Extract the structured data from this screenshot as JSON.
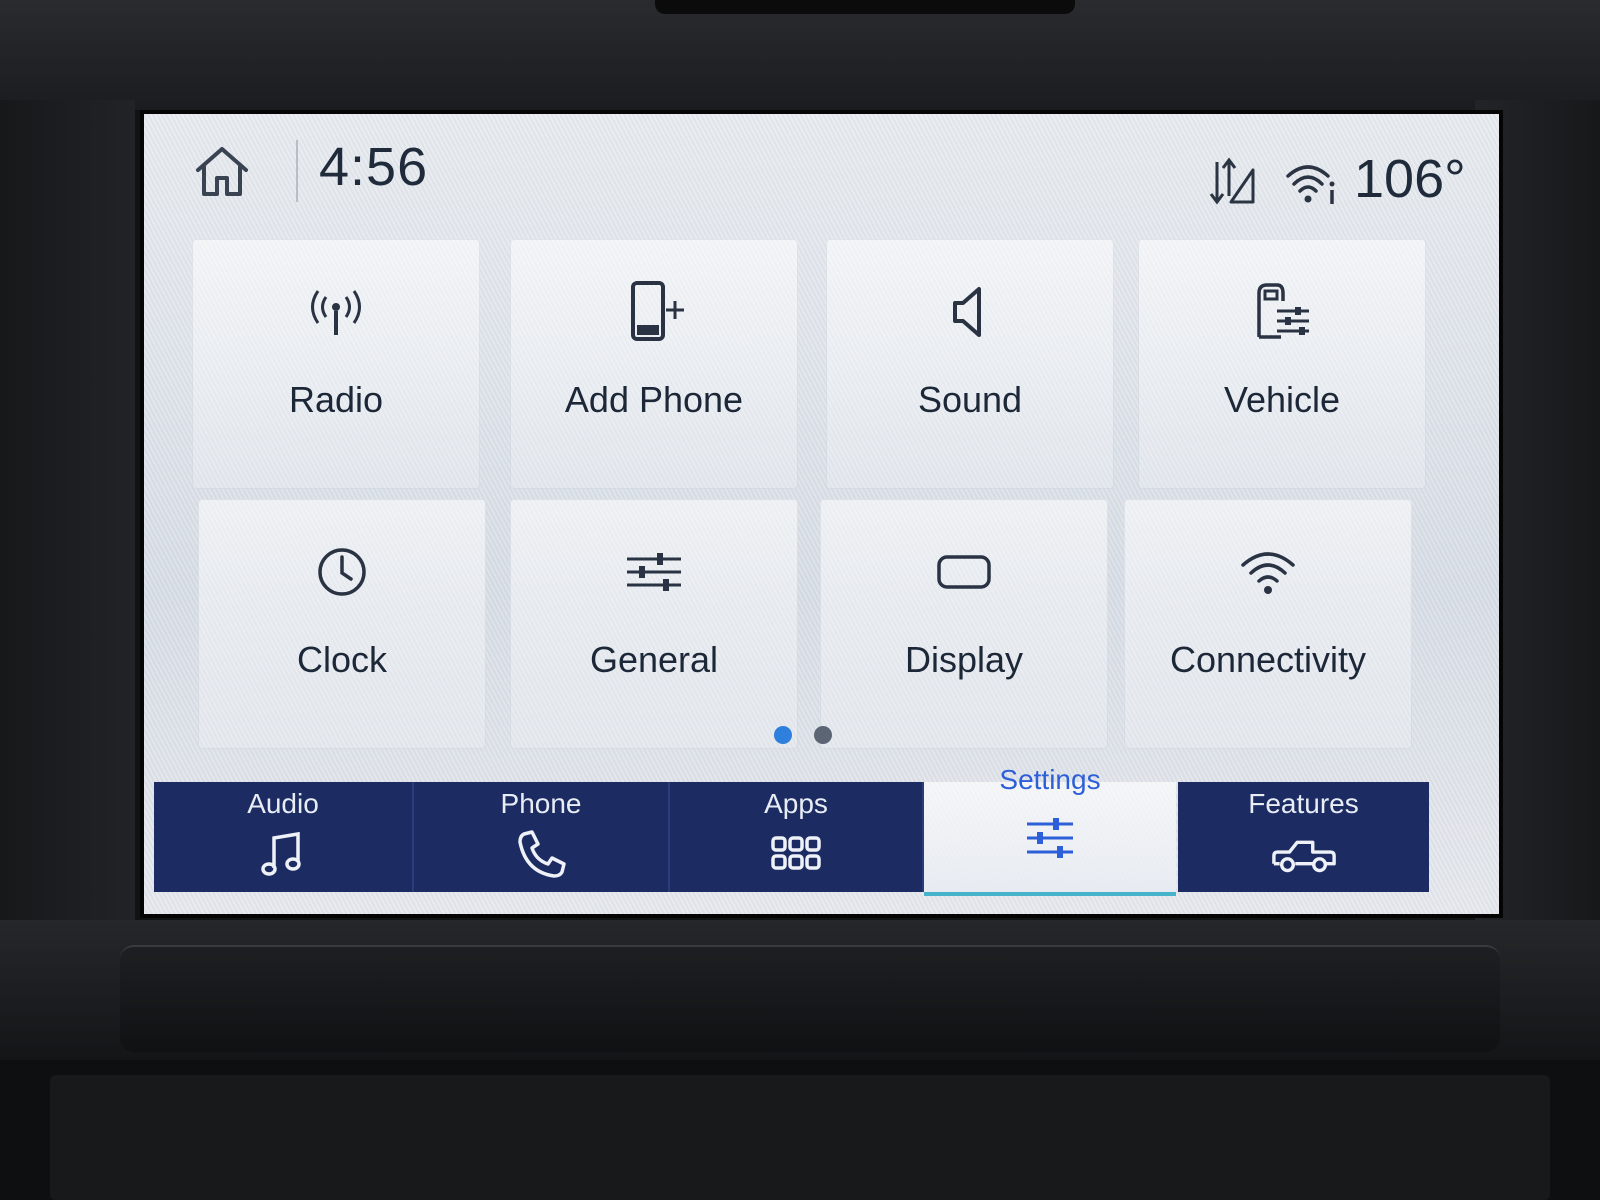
{
  "status": {
    "time": "4:56",
    "temperature": "106°"
  },
  "tiles": [
    {
      "label": "Radio",
      "icon": "radio-antenna-icon"
    },
    {
      "label": "Add Phone",
      "icon": "add-phone-icon"
    },
    {
      "label": "Sound",
      "icon": "speaker-icon"
    },
    {
      "label": "Vehicle",
      "icon": "vehicle-settings-icon"
    },
    {
      "label": "Clock",
      "icon": "clock-icon"
    },
    {
      "label": "General",
      "icon": "sliders-icon"
    },
    {
      "label": "Display",
      "icon": "display-icon"
    },
    {
      "label": "Connectivity",
      "icon": "wifi-icon"
    }
  ],
  "pager": {
    "current": 1,
    "total": 2
  },
  "nav": [
    {
      "label": "Audio",
      "icon": "music-note-icon",
      "active": false
    },
    {
      "label": "Phone",
      "icon": "phone-handset-icon",
      "active": false
    },
    {
      "label": "Apps",
      "icon": "apps-grid-icon",
      "active": false
    },
    {
      "label": "Settings",
      "icon": "settings-sliders-icon",
      "active": true
    },
    {
      "label": "Features",
      "icon": "truck-icon",
      "active": false
    }
  ],
  "colors": {
    "nav_background": "#1c2c63",
    "active_accent": "#2d5fd8",
    "pager_active": "#2f7fdc",
    "pager_inactive": "#5c6574",
    "text_dark": "#1c2738"
  }
}
